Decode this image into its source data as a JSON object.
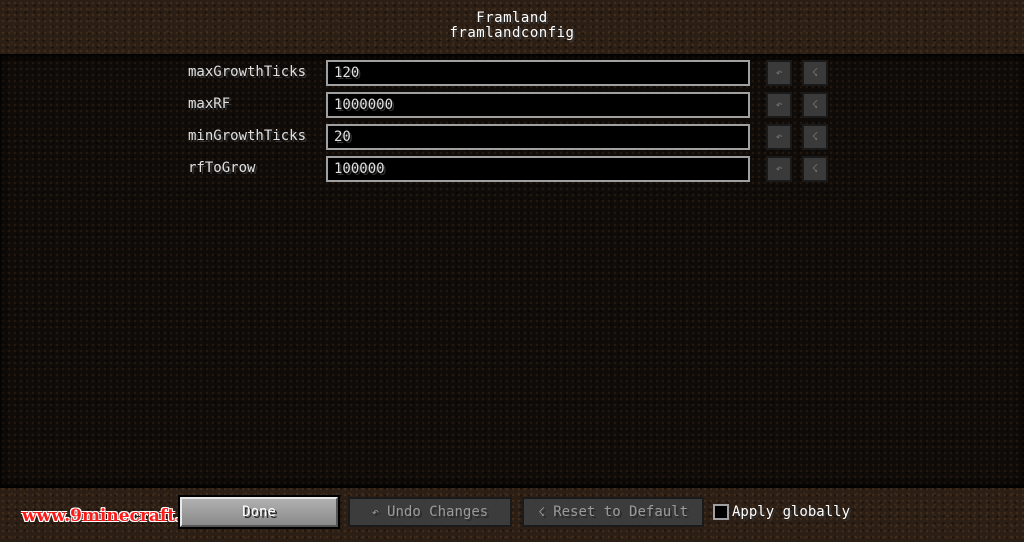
{
  "header": {
    "title": "Framland",
    "subtitle": "framlandconfig"
  },
  "entries": [
    {
      "label": "maxGrowthTicks",
      "value": "120"
    },
    {
      "label": "maxRF",
      "value": "1000000"
    },
    {
      "label": "minGrowthTicks",
      "value": "20"
    },
    {
      "label": "rfToGrow",
      "value": "100000"
    }
  ],
  "entry_buttons": {
    "undo_glyph": "↶",
    "reset_glyph": "☇"
  },
  "footer": {
    "done_label": "Done",
    "undo_label": "Undo Changes",
    "undo_glyph": "↶",
    "reset_label": "Reset to Default",
    "reset_glyph": "☇",
    "apply_globally_label": "Apply globally",
    "apply_globally_checked": false
  },
  "watermark": "www.9minecraft.net",
  "colors": {
    "watermark": "#ff1a1a",
    "text": "#e0e0e0",
    "input_border": "#a0a0a0"
  }
}
